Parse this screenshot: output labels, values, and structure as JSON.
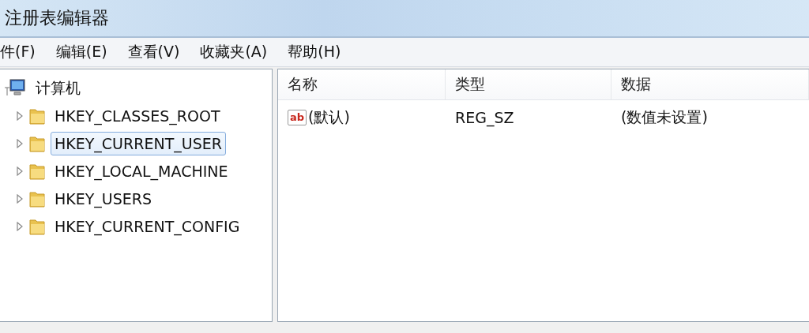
{
  "window": {
    "title": "注册表编辑器"
  },
  "menu": [
    "件(F)",
    "编辑(E)",
    "查看(V)",
    "收藏夹(A)",
    "帮助(H)"
  ],
  "tree": {
    "label": "计算机",
    "children": [
      {
        "label": "HKEY_CLASSES_ROOT",
        "expanded": false,
        "selected": false
      },
      {
        "label": "HKEY_CURRENT_USER",
        "expanded": false,
        "selected": true
      },
      {
        "label": "HKEY_LOCAL_MACHINE",
        "expanded": false,
        "selected": false
      },
      {
        "label": "HKEY_USERS",
        "expanded": false,
        "selected": false
      },
      {
        "label": "HKEY_CURRENT_CONFIG",
        "expanded": false,
        "selected": false
      }
    ]
  },
  "table": {
    "columns": [
      "名称",
      "类型",
      "数据"
    ],
    "rows": [
      {
        "icon_label": "ab",
        "name": "(默认)",
        "type": "REG_SZ",
        "data": "(数值未设置)",
        "selected": false
      }
    ]
  }
}
